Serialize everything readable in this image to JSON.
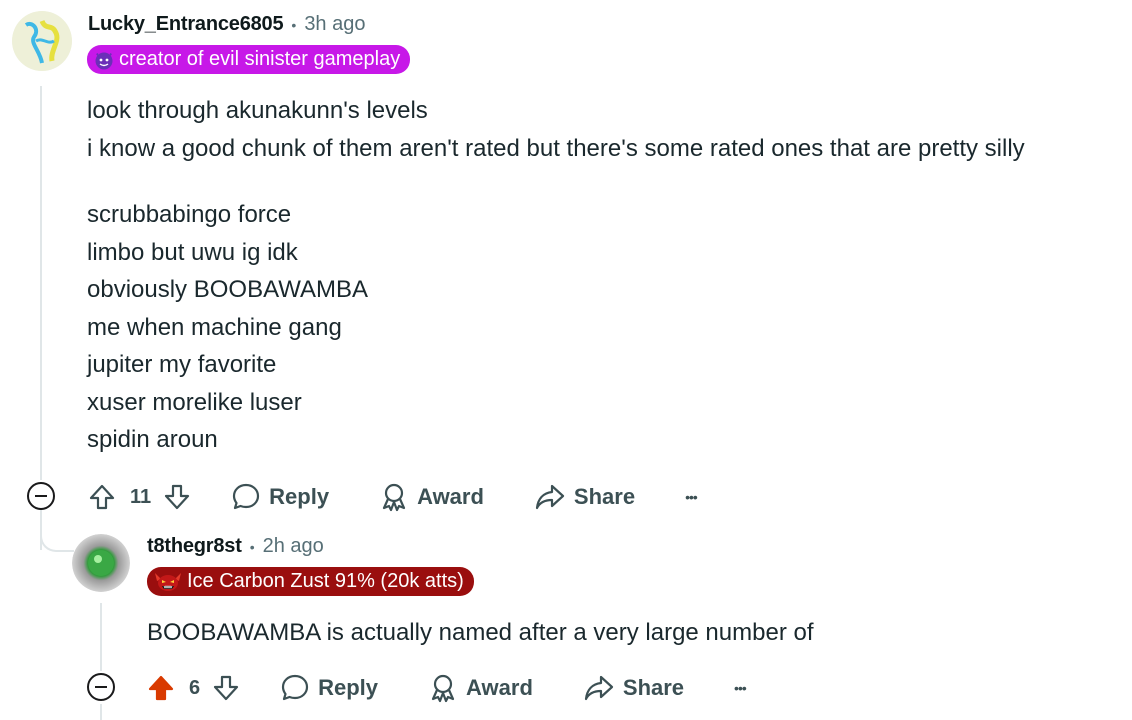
{
  "comment1": {
    "username": "Lucky_Entrance6805",
    "separator": "•",
    "time": "3h ago",
    "flair_text": "creator of evil sinister gameplay",
    "flair_color": "#c718e8",
    "body": [
      "look through akunakunn's levels",
      "i know a good chunk of them aren't rated but there's some rated ones that are pretty silly",
      "",
      "scrubbabingo force",
      "limbo but uwu ig idk",
      "obviously BOOBAWAMBA",
      "me when machine gang",
      "jupiter my favorite",
      "xuser morelike luser",
      "spidin aroun"
    ],
    "votes": "11",
    "reply_label": "Reply",
    "award_label": "Award",
    "share_label": "Share",
    "more_label": "•••"
  },
  "comment2": {
    "username": "t8thegr8st",
    "separator": "•",
    "time": "2h ago",
    "flair_text": "Ice Carbon Zust 91% (20k atts)",
    "flair_color": "#9a0e0e",
    "body": [
      "BOOBAWAMBA is actually named after a very large number of"
    ],
    "votes": "6",
    "upvote_color": "#d93a00",
    "reply_label": "Reply",
    "award_label": "Award",
    "share_label": "Share",
    "more_label": "•••"
  }
}
